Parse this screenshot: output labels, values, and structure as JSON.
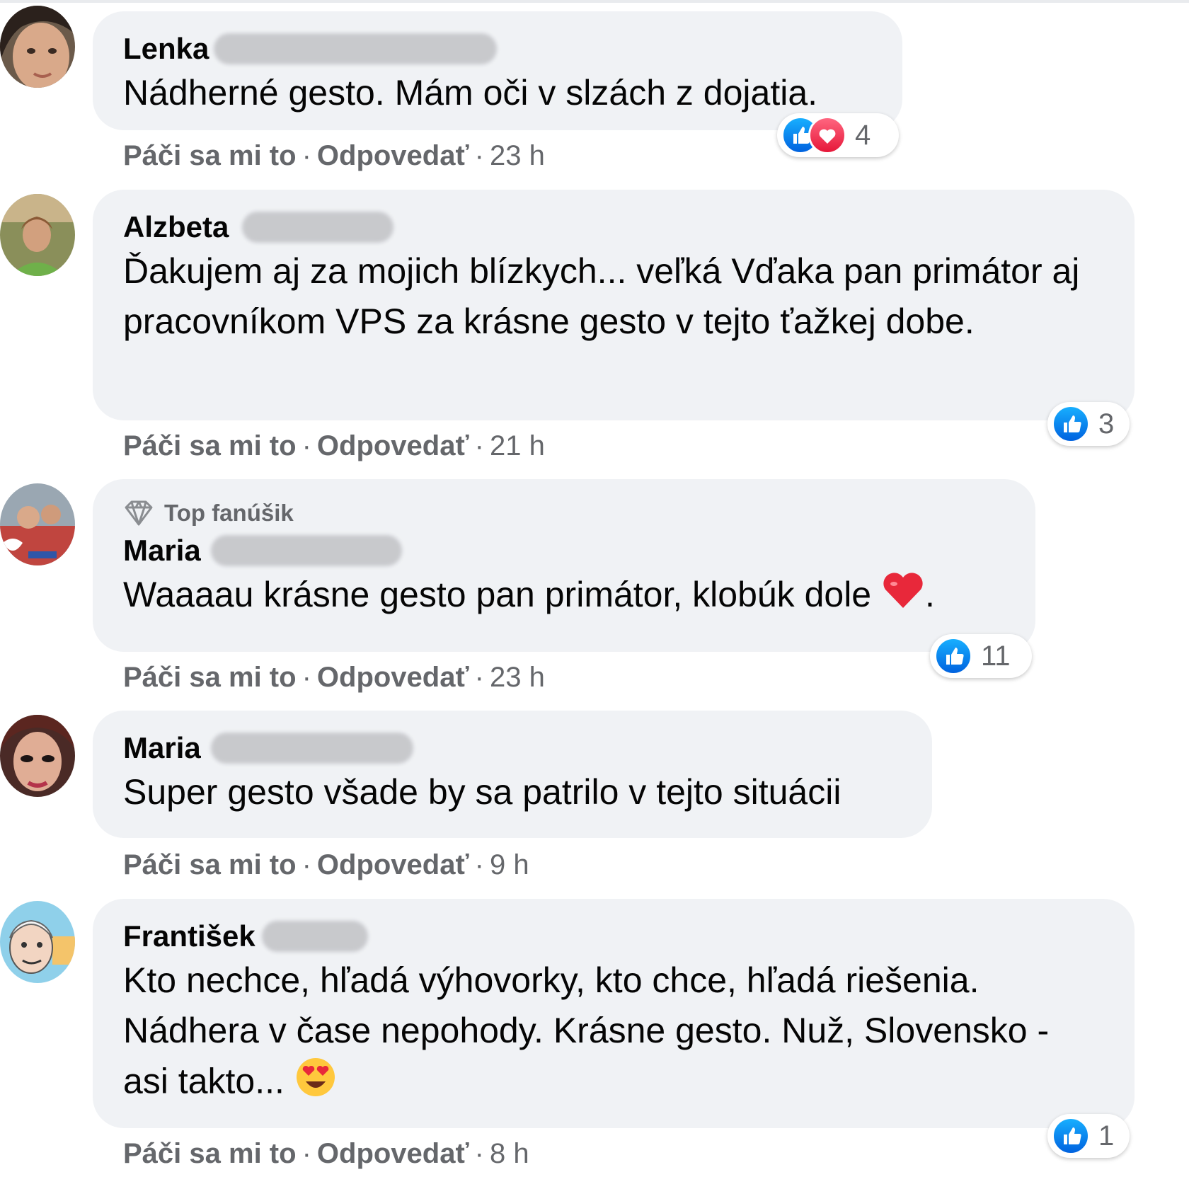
{
  "comments": [
    {
      "author": "Lenka",
      "badge": "",
      "text": "Nádherné gesto. Mám oči v slzách z dojatia.",
      "like_label": "Páči sa mi to",
      "reply_label": "Odpovedať",
      "time": "23 h",
      "reaction_count": "4",
      "reactions": [
        "like-icon",
        "love-icon"
      ]
    },
    {
      "author": "Alzbeta",
      "badge": "",
      "text": "Ďakujem aj za mojich blízkych... veľká Vďaka pan primátor aj pracovníkom VPS za krásne gesto v tejto ťažkej dobe.",
      "like_label": "Páči sa mi to",
      "reply_label": "Odpovedať",
      "time": "21 h",
      "reaction_count": "3",
      "reactions": [
        "like-icon"
      ]
    },
    {
      "author": "Maria",
      "badge": "Top fanúšik",
      "text": "Waaaau krásne gesto pan primátor, klobúk dole",
      "text_suffix": ".",
      "like_label": "Páči sa mi to",
      "reply_label": "Odpovedať",
      "time": "23 h",
      "reaction_count": "11",
      "reactions": [
        "like-icon"
      ]
    },
    {
      "author": "Maria",
      "badge": "",
      "text": "Super gesto všade by sa patrilo v tejto situácii",
      "like_label": "Páči sa mi to",
      "reply_label": "Odpovedať",
      "time": "9 h",
      "reaction_count": "",
      "reactions": []
    },
    {
      "author": "František",
      "badge": "",
      "text": "Kto nechce, hľadá výhovorky, kto chce, hľadá riešenia. Nádhera v čase nepohody. Krásne gesto. Nuž, Slovensko - asi takto...",
      "like_label": "Páči sa mi to",
      "reply_label": "Odpovedať",
      "time": "8 h",
      "reaction_count": "1",
      "reactions": [
        "like-icon"
      ]
    }
  ],
  "separator": "·",
  "colors": {
    "bubble": "#f0f2f5",
    "meta_text": "#65676b",
    "like_blue": "#1877f2",
    "love_red": "#f33e58"
  }
}
